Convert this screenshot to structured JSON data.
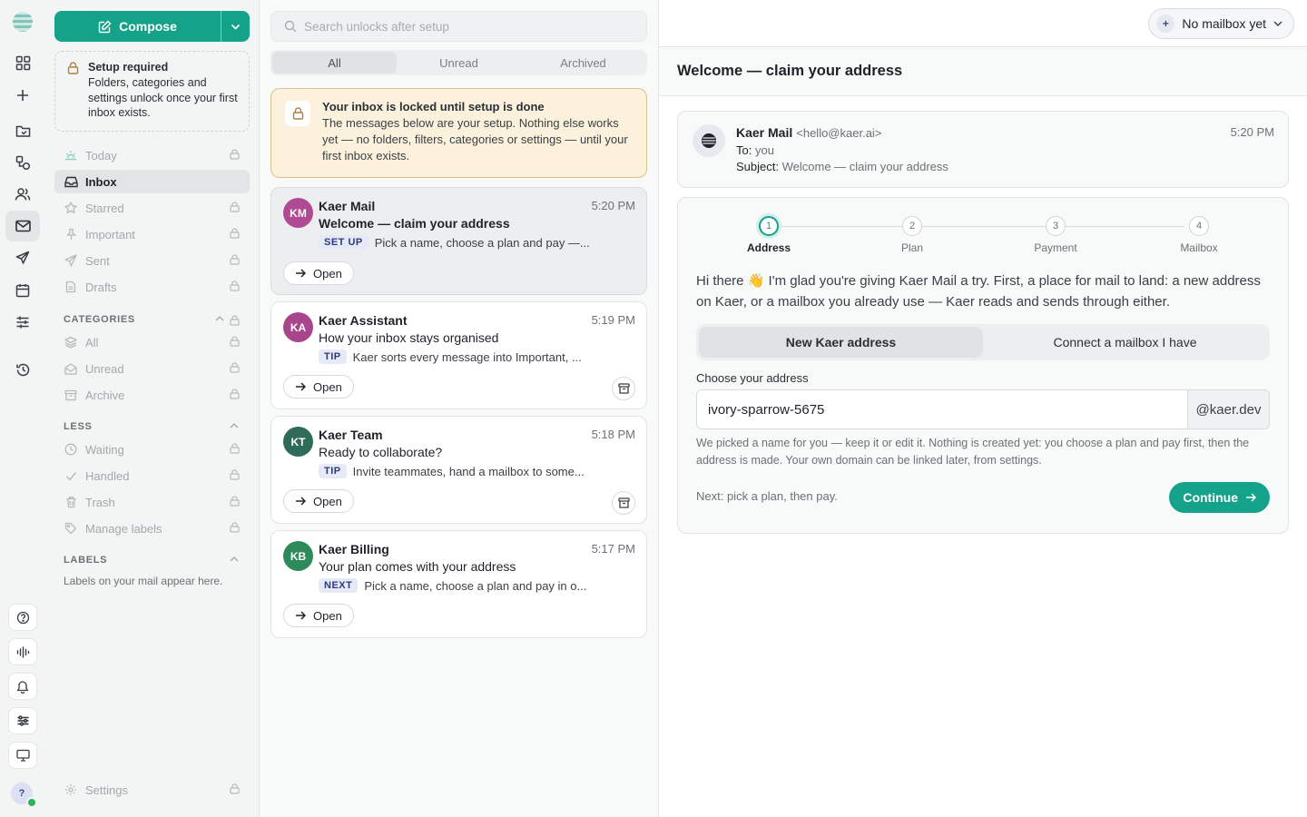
{
  "colors": {
    "accent": "#14a38a",
    "banner_bg": "#fbf1dc",
    "tag_bg": "#e6e9f7"
  },
  "rail": {
    "icons": [
      "logo-icon",
      "grid-icon",
      "plus-icon",
      "folder-icon",
      "workflow-icon",
      "contacts-icon",
      "mail-icon",
      "send-icon",
      "calendar-icon",
      "sliders-icon",
      "history-icon",
      "help-icon",
      "waveform-icon",
      "bell-icon",
      "adjust-icon",
      "monitor-icon"
    ],
    "avatar_initial": "?"
  },
  "sidebar": {
    "compose_label": "Compose",
    "setup": {
      "title": "Setup required",
      "description": "Folders, categories and settings unlock once your first inbox exists."
    },
    "nav": [
      {
        "label": "Today",
        "icon": "sunrise-icon",
        "locked": true
      },
      {
        "label": "Inbox",
        "icon": "inbox-icon",
        "active": true
      },
      {
        "label": "Starred",
        "icon": "star-icon",
        "locked": true
      },
      {
        "label": "Important",
        "icon": "pin-icon",
        "locked": true
      },
      {
        "label": "Sent",
        "icon": "send-icon",
        "locked": true
      },
      {
        "label": "Drafts",
        "icon": "draft-icon",
        "locked": true
      }
    ],
    "categories_heading": "CATEGORIES",
    "categories": [
      {
        "label": "All",
        "icon": "layers-icon"
      },
      {
        "label": "Unread",
        "icon": "envelope-open-icon"
      },
      {
        "label": "Archive",
        "icon": "archive-icon"
      }
    ],
    "less_heading": "LESS",
    "less": [
      {
        "label": "Waiting",
        "icon": "clock-icon"
      },
      {
        "label": "Handled",
        "icon": "check-icon"
      },
      {
        "label": "Trash",
        "icon": "trash-icon"
      },
      {
        "label": "Manage labels",
        "icon": "tag-icon"
      }
    ],
    "labels_heading": "LABELS",
    "labels_note": "Labels on your mail appear here.",
    "settings_label": "Settings"
  },
  "list": {
    "search_placeholder": "Search unlocks after setup",
    "tabs": [
      "All",
      "Unread",
      "Archived"
    ],
    "banner": {
      "title": "Your inbox is locked until setup is done",
      "body": "The messages below are your setup. Nothing else works yet — no folders, filters, categories or settings — until your first inbox exists."
    },
    "messages": [
      {
        "initials": "KM",
        "avatar_color": "#b04a93",
        "from": "Kaer Mail",
        "time": "5:20 PM",
        "subject": "Welcome — claim your address",
        "tag": "SET UP",
        "snippet": "Pick a name, choose a plan and pay —...",
        "open_label": "Open"
      },
      {
        "initials": "KA",
        "avatar_color": "#a8468c",
        "from": "Kaer Assistant",
        "time": "5:19 PM",
        "subject": "How your inbox stays organised",
        "tag": "TIP",
        "snippet": "Kaer sorts every message into Important, ...",
        "open_label": "Open"
      },
      {
        "initials": "KT",
        "avatar_color": "#2e6b58",
        "from": "Kaer Team",
        "time": "5:18 PM",
        "subject": "Ready to collaborate?",
        "tag": "TIP",
        "snippet": "Invite teammates, hand a mailbox to some...",
        "open_label": "Open"
      },
      {
        "initials": "KB",
        "avatar_color": "#2f8a5a",
        "from": "Kaer Billing",
        "time": "5:17 PM",
        "subject": "Your plan comes with your address",
        "tag": "NEXT",
        "snippet": "Pick a name, choose a plan and pay in o...",
        "open_label": "Open"
      }
    ]
  },
  "pane": {
    "mailbox_button": "No mailbox yet",
    "mailbox_plus": "+",
    "title": "Welcome — claim your address",
    "header": {
      "from_name": "Kaer Mail",
      "from_addr": "<hello@kaer.ai>",
      "to_label": "To:",
      "to_value": "you",
      "subject_label": "Subject:",
      "subject_value": "Welcome — claim your address",
      "time": "5:20 PM"
    },
    "steps": [
      {
        "num": "1",
        "label": "Address"
      },
      {
        "num": "2",
        "label": "Plan"
      },
      {
        "num": "3",
        "label": "Payment"
      },
      {
        "num": "4",
        "label": "Mailbox"
      }
    ],
    "current_step": 1,
    "intro": "Hi there 👋 I'm glad you're giving Kaer Mail a try. First, a place for mail to land: a new address on Kaer, or a mailbox you already use — Kaer reads and sends through either.",
    "tabs": [
      "New Kaer address",
      "Connect a mailbox I have"
    ],
    "address_label": "Choose your address",
    "address_value": "ivory-sparrow-5675",
    "address_suffix": "@kaer.dev",
    "hint": "We picked a name for you — keep it or edit it. Nothing is created yet: you choose a plan and pay first, then the address is made. Your own domain can be linked later, from settings.",
    "next_note": "Next: pick a plan, then pay.",
    "continue_label": "Continue"
  }
}
